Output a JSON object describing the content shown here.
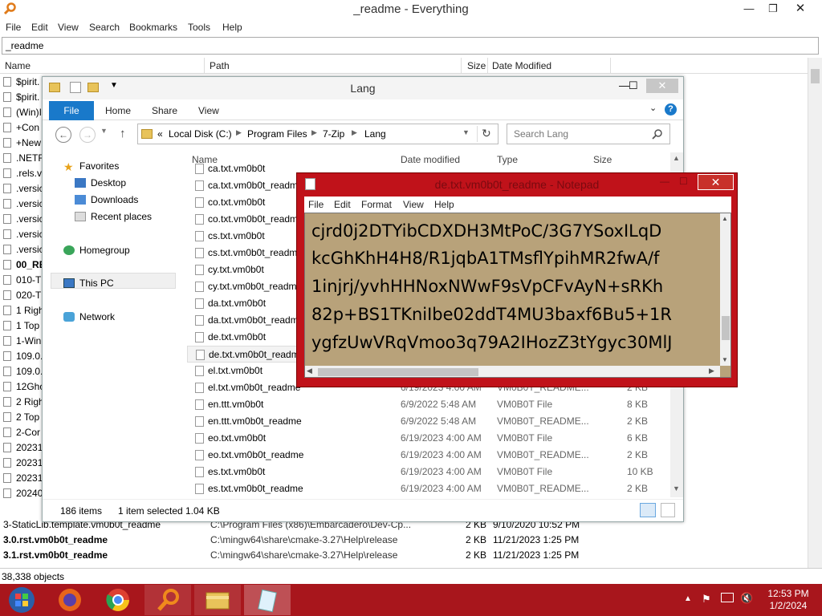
{
  "everything": {
    "title": "_readme - Everything",
    "menu": [
      "File",
      "Edit",
      "View",
      "Search",
      "Bookmarks",
      "Tools",
      "Help"
    ],
    "search_value": "_readme",
    "columns": {
      "name": "Name",
      "path": "Path",
      "size": "Size",
      "date": "Date Modified"
    },
    "left_rows": [
      "$pirit.",
      "$pirit.",
      "(Win)I",
      "+Con",
      "+New",
      ".NETF",
      ".rels.v",
      ".versic",
      ".versic",
      ".versic",
      ".versic",
      ".versic",
      "00_RE",
      "010-T",
      "020-T",
      "1 Righ",
      "1 Top",
      "1-Win",
      "109.0.",
      "109.0.",
      "12Gho",
      "2 Righ",
      "2 Top",
      "2-Cor",
      "20231",
      "20231",
      "20231",
      "20240"
    ],
    "bottom_rows": [
      {
        "name": "3-StaticLib.template.vm0b0t_readme",
        "path": "C:\\Program Files (x86)\\Embarcadero\\Dev-Cp...",
        "size": "2 KB",
        "date": "9/10/2020 10:52 PM"
      },
      {
        "name": "3.0.rst.vm0b0t_readme",
        "path": "C:\\mingw64\\share\\cmake-3.27\\Help\\release",
        "size": "2 KB",
        "date": "11/21/2023 1:25 PM"
      },
      {
        "name": "3.1.rst.vm0b0t_readme",
        "path": "C:\\mingw64\\share\\cmake-3.27\\Help\\release",
        "size": "2 KB",
        "date": "11/21/2023 1:25 PM"
      }
    ],
    "status": "38,338 objects"
  },
  "explorer": {
    "title": "Lang",
    "tabs": [
      "File",
      "Home",
      "Share",
      "View"
    ],
    "breadcrumb": [
      "«",
      "Local Disk (C:)",
      "Program Files",
      "7-Zip",
      "Lang"
    ],
    "search_placeholder": "Search Lang",
    "nav": {
      "favorites": "Favorites",
      "desktop": "Desktop",
      "downloads": "Downloads",
      "recent": "Recent places",
      "homegroup": "Homegroup",
      "thispc": "This PC",
      "network": "Network"
    },
    "columns": {
      "name": "Name",
      "date": "Date modified",
      "type": "Type",
      "size": "Size"
    },
    "files": [
      {
        "name": "ca.txt.vm0b0t",
        "date": "",
        "type": "",
        "size": ""
      },
      {
        "name": "ca.txt.vm0b0t_readme",
        "date": "",
        "type": "",
        "size": ""
      },
      {
        "name": "co.txt.vm0b0t",
        "date": "",
        "type": "",
        "size": ""
      },
      {
        "name": "co.txt.vm0b0t_readme",
        "date": "",
        "type": "",
        "size": ""
      },
      {
        "name": "cs.txt.vm0b0t",
        "date": "",
        "type": "",
        "size": ""
      },
      {
        "name": "cs.txt.vm0b0t_readme",
        "date": "",
        "type": "",
        "size": ""
      },
      {
        "name": "cy.txt.vm0b0t",
        "date": "",
        "type": "",
        "size": ""
      },
      {
        "name": "cy.txt.vm0b0t_readme",
        "date": "",
        "type": "",
        "size": ""
      },
      {
        "name": "da.txt.vm0b0t",
        "date": "",
        "type": "",
        "size": ""
      },
      {
        "name": "da.txt.vm0b0t_readme",
        "date": "",
        "type": "",
        "size": ""
      },
      {
        "name": "de.txt.vm0b0t",
        "date": "",
        "type": "",
        "size": ""
      },
      {
        "name": "de.txt.vm0b0t_readme",
        "date": "",
        "type": "",
        "size": ""
      },
      {
        "name": "el.txt.vm0b0t",
        "date": "",
        "type": "",
        "size": ""
      },
      {
        "name": "el.txt.vm0b0t_readme",
        "date": "6/19/2023 4:00 AM",
        "type": "VM0B0T_README...",
        "size": "2 KB"
      },
      {
        "name": "en.ttt.vm0b0t",
        "date": "6/9/2022 5:48 AM",
        "type": "VM0B0T File",
        "size": "8 KB"
      },
      {
        "name": "en.ttt.vm0b0t_readme",
        "date": "6/9/2022 5:48 AM",
        "type": "VM0B0T_README...",
        "size": "2 KB"
      },
      {
        "name": "eo.txt.vm0b0t",
        "date": "6/19/2023 4:00 AM",
        "type": "VM0B0T File",
        "size": "6 KB"
      },
      {
        "name": "eo.txt.vm0b0t_readme",
        "date": "6/19/2023 4:00 AM",
        "type": "VM0B0T_README...",
        "size": "2 KB"
      },
      {
        "name": "es.txt.vm0b0t",
        "date": "6/19/2023 4:00 AM",
        "type": "VM0B0T File",
        "size": "10 KB"
      },
      {
        "name": "es.txt.vm0b0t_readme",
        "date": "6/19/2023 4:00 AM",
        "type": "VM0B0T_README...",
        "size": "2 KB"
      }
    ],
    "status": {
      "count": "186 items",
      "selected": "1 item selected",
      "size": "1.04 KB"
    }
  },
  "notepad": {
    "title": "de.txt.vm0b0t_readme - Notepad",
    "menu": [
      "File",
      "Edit",
      "Format",
      "View",
      "Help"
    ],
    "lines": [
      "cjrd0j2DTYibCDXDH3MtPoC/3G7YSoxILqD",
      "kcGhKhH4H8/R1jqbA1TMsflYpihMR2fwA/f",
      "1injrj/yvhHHNoxNWwF9sVpCFvAyN+sRKh",
      "82p+BS1TKniIbe02ddT4MU3baxf6Bu5+1R",
      "ygfzUwVRqVmoo3q79A2IHozZ3tYgyc30MlJ"
    ]
  },
  "taskbar": {
    "time": "12:53 PM",
    "date": "1/2/2024",
    "apps": [
      "firefox-icon",
      "chrome-icon",
      "search-icon",
      "file-explorer-icon",
      "notepad-icon"
    ]
  },
  "colors": {
    "taskbar": "#a8161c",
    "desktop": "#b8a27a",
    "accent": "#1979ca"
  }
}
